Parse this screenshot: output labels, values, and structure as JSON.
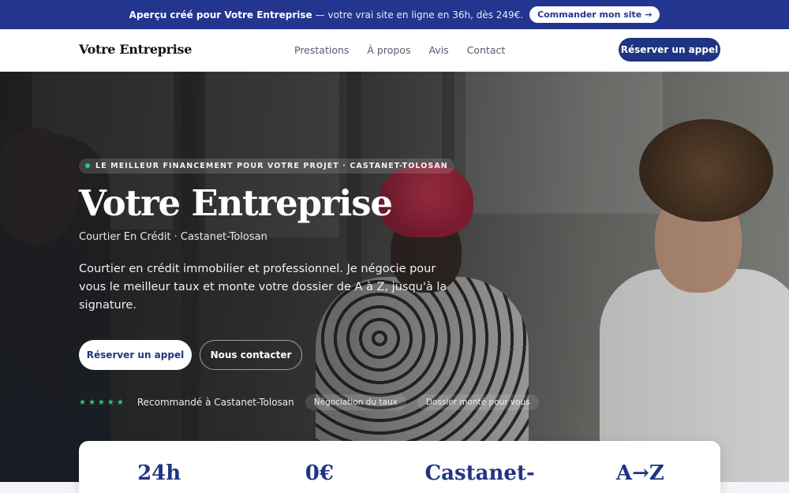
{
  "promo": {
    "strong": "Aperçu créé pour Votre Entreprise",
    "rest": "— votre vrai site en ligne en 36h, dès 249€.",
    "cta": "Commander mon site →"
  },
  "nav": {
    "brand": "Votre Entreprise",
    "items": [
      "Prestations",
      "À propos",
      "Avis",
      "Contact"
    ],
    "cta": "Réserver un appel"
  },
  "hero": {
    "eyebrow": "LE MEILLEUR FINANCEMENT POUR VOTRE PROJET · CASTANET-TOLOSAN",
    "title": "Votre Entreprise",
    "subtitle": "Courtier En Crédit · Castanet-Tolosan",
    "description": "Courtier en crédit immobilier et professionnel. Je négocie pour vous le meilleur taux et monte votre dossier de A à Z, jusqu'à la signature.",
    "primary_cta": "Réserver un appel",
    "secondary_cta": "Nous contacter",
    "stars": "★★★★★",
    "proof_text": "Recommandé à Castanet-Tolosan",
    "chips": [
      "Négociation du taux",
      "Dossier monté pour vous"
    ]
  },
  "stats": [
    "24h",
    "0€",
    "Castanet-",
    "A→Z"
  ],
  "colors": {
    "brand_blue": "#1f3482",
    "promo_bg": "#23358e",
    "accent_green": "#2ecc71"
  }
}
